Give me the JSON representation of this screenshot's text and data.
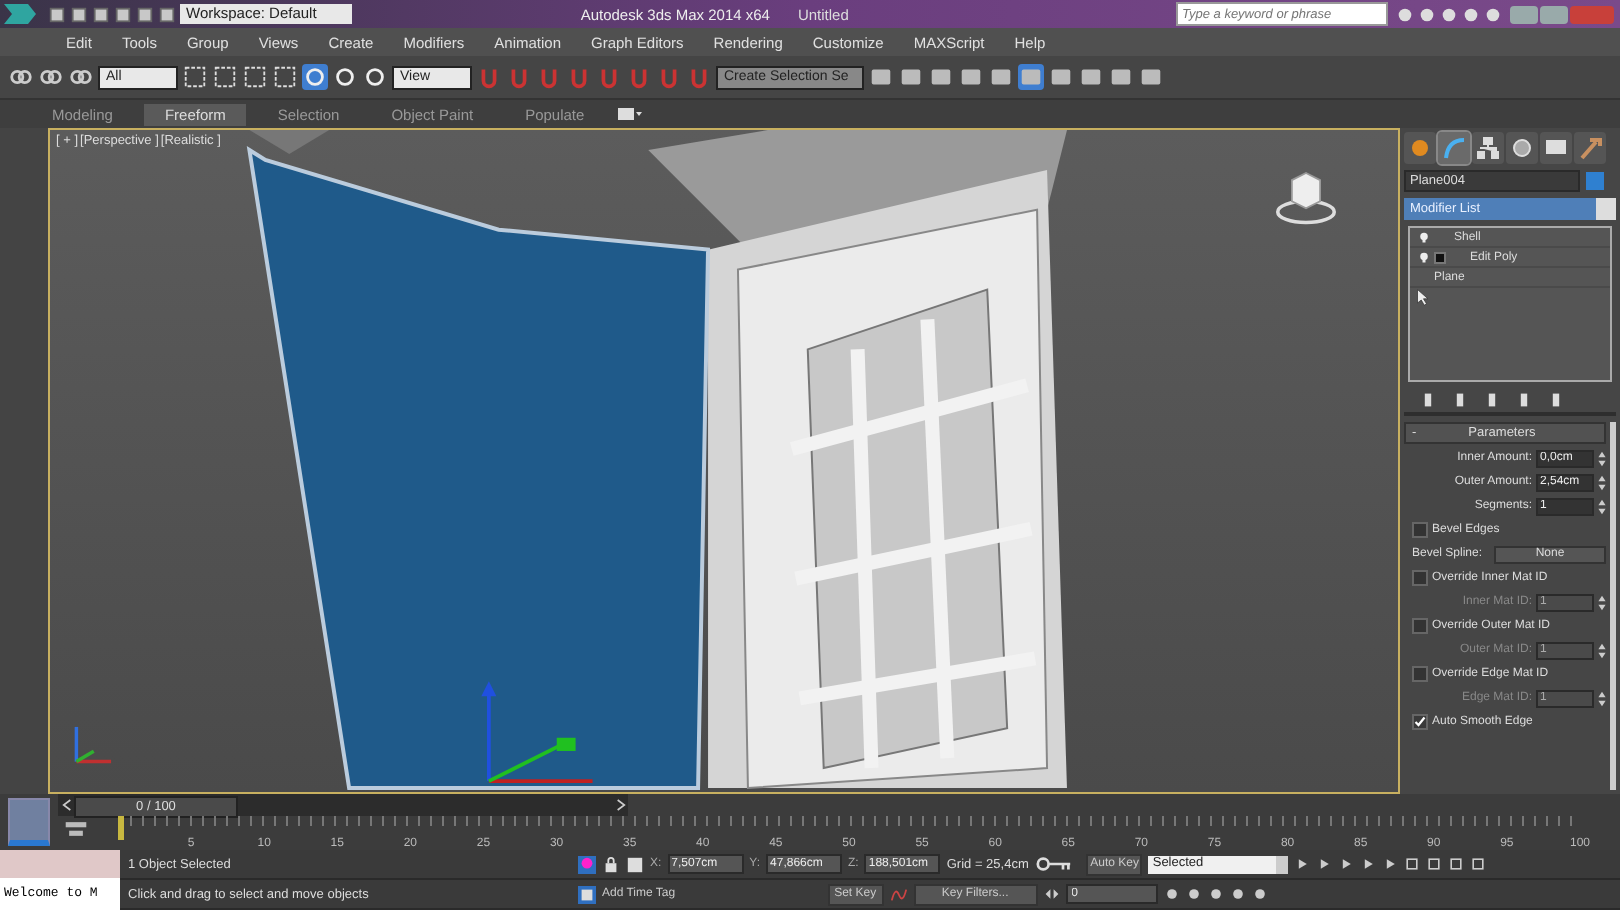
{
  "title_bar": {
    "workspace": "Workspace: Default",
    "app_title": "Autodesk 3ds Max 2014 x64",
    "document": "Untitled",
    "search": {
      "placeholder": "Type a keyword or phrase"
    }
  },
  "menu": [
    "Edit",
    "Tools",
    "Group",
    "Views",
    "Create",
    "Modifiers",
    "Animation",
    "Graph Editors",
    "Rendering",
    "Customize",
    "MAXScript",
    "Help"
  ],
  "toolbar": {
    "selection_filter": "All",
    "reference_coord": "View",
    "named_selection": "Create Selection Se"
  },
  "ribbon_tabs": [
    {
      "label": "Modeling",
      "selected": false
    },
    {
      "label": "Freeform",
      "selected": true
    },
    {
      "label": "Selection",
      "selected": false
    },
    {
      "label": "Object Paint",
      "selected": false
    },
    {
      "label": "Populate",
      "selected": false
    }
  ],
  "viewport": {
    "labels": [
      "[ + ]",
      "[Perspective ]",
      "[Realistic ]"
    ]
  },
  "command_panel": {
    "tabs": [
      {
        "kind": "create",
        "selected": false
      },
      {
        "kind": "modify",
        "selected": true
      },
      {
        "kind": "hierarchy",
        "selected": false
      },
      {
        "kind": "motion",
        "selected": false
      },
      {
        "kind": "display",
        "selected": false
      },
      {
        "kind": "utilities",
        "selected": false
      }
    ],
    "object_name": "Plane004",
    "modifier_list": "Modifier List",
    "stack": [
      {
        "label": "Shell",
        "kind": "modifier"
      },
      {
        "label": "Edit Poly",
        "kind": "expandable"
      },
      {
        "label": "Plane",
        "kind": "base"
      }
    ],
    "rollout": {
      "toggle": "-",
      "title": "Parameters",
      "rows": [
        {
          "kind": "spinner",
          "label": "Inner Amount:",
          "value": "0,0cm",
          "disabled": false
        },
        {
          "kind": "spinner",
          "label": "Outer Amount:",
          "value": "2,54cm",
          "disabled": false
        },
        {
          "kind": "spinner",
          "label": "Segments:",
          "value": "1",
          "disabled": false
        },
        {
          "kind": "checkbox",
          "label": "Bevel Edges",
          "checked": false
        },
        {
          "kind": "button",
          "label": "Bevel Spline:",
          "value": "None"
        },
        {
          "kind": "checkbox",
          "label": "Override Inner Mat ID",
          "checked": false
        },
        {
          "kind": "spinner",
          "label": "Inner Mat ID:",
          "value": "1",
          "disabled": true
        },
        {
          "kind": "checkbox",
          "label": "Override Outer Mat ID",
          "checked": false
        },
        {
          "kind": "spinner",
          "label": "Outer Mat ID:",
          "value": "1",
          "disabled": true
        },
        {
          "kind": "checkbox",
          "label": "Override Edge Mat ID",
          "checked": false
        },
        {
          "kind": "spinner",
          "label": "Edge Mat ID:",
          "value": "1",
          "disabled": true
        },
        {
          "kind": "checkbox",
          "label": "Auto Smooth Edge",
          "checked": true
        }
      ]
    }
  },
  "timeline": {
    "slider": "0 / 100",
    "level": 0,
    "ticks": [
      "5",
      "10",
      "15",
      "20",
      "25",
      "30",
      "35",
      "40",
      "45",
      "50",
      "55",
      "60",
      "65",
      "70",
      "75",
      "80",
      "85",
      "90",
      "95",
      "100"
    ]
  },
  "status_bar": {
    "welcome": "Welcome to M",
    "selection": "1 Object Selected",
    "prompt": "Click and drag to select and move objects",
    "coords": [
      {
        "axis": "X:",
        "value": "7,507cm"
      },
      {
        "axis": "Y:",
        "value": "47,866cm"
      },
      {
        "axis": "Z:",
        "value": "188,501cm"
      }
    ],
    "grid": "Grid = 25,4cm",
    "add_time_tag": "Add Time Tag",
    "auto_key": "Auto Key",
    "key_mode": "Selected",
    "set_key": "Set Key",
    "key_filters": "Key Filters...",
    "frame": "0"
  }
}
